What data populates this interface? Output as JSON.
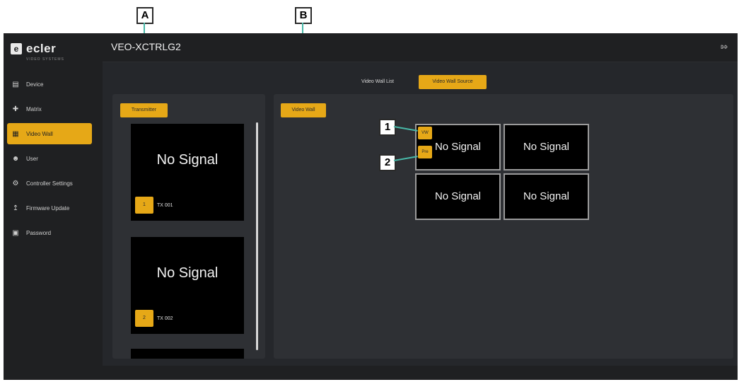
{
  "callouts": {
    "a": "A",
    "b": "B",
    "one": "1",
    "two": "2"
  },
  "colors": {
    "accent": "#e6a817",
    "background": "#1f2022",
    "panel": "#2e3034",
    "callout_line": "#48b8a8"
  },
  "logo": {
    "text": "ecler",
    "subtext": "VIDEO SYSTEMS",
    "icon": "ecler-logo-icon"
  },
  "sidebar": {
    "items": [
      {
        "label": "Device",
        "icon": "device-icon",
        "active": false
      },
      {
        "label": "Matrix",
        "icon": "matrix-icon",
        "active": false
      },
      {
        "label": "Video Wall",
        "icon": "grid-icon",
        "active": true
      },
      {
        "label": "User",
        "icon": "user-icon",
        "active": false
      },
      {
        "label": "Controller Settings",
        "icon": "gear-icon",
        "active": false
      },
      {
        "label": "Firmware Update",
        "icon": "upload-icon",
        "active": false
      },
      {
        "label": "Password",
        "icon": "lock-icon",
        "active": false
      }
    ]
  },
  "header": {
    "title": "VEO-XCTRLG2",
    "logout_icon": "logout-icon"
  },
  "tabs": {
    "list": "Video Wall List",
    "source": "Video Wall Source"
  },
  "transmitter_panel": {
    "button": "Transmitter",
    "cards": [
      {
        "signal": "No Signal",
        "number": "1",
        "name": "TX 001"
      },
      {
        "signal": "No Signal",
        "number": "2",
        "name": "TX 002"
      }
    ]
  },
  "wall_panel": {
    "button": "Video Wall",
    "vw_label": "VW",
    "pre_label": "Pre",
    "cells": [
      "No Signal",
      "No Signal",
      "No Signal",
      "No Signal"
    ]
  }
}
